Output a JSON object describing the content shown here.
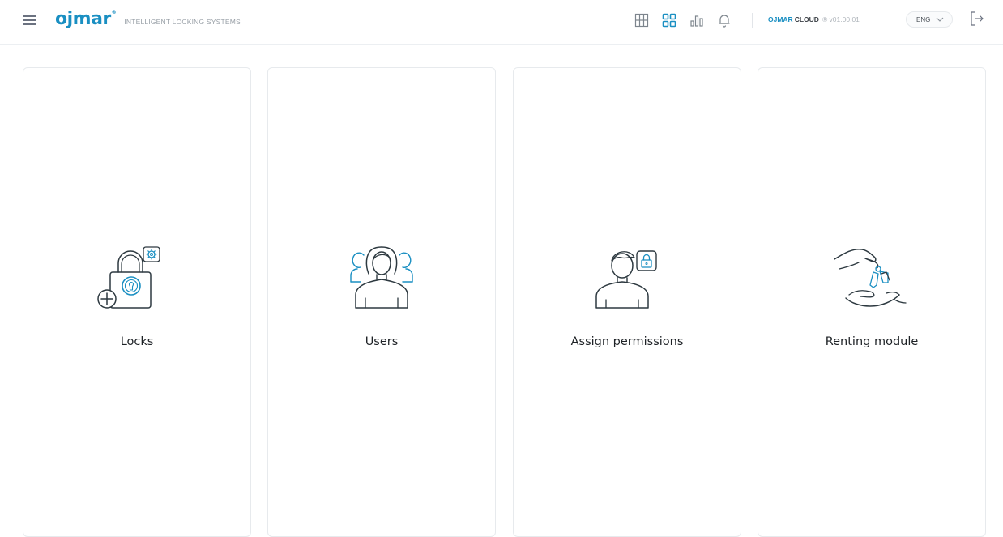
{
  "header": {
    "logo_text": "ojmar",
    "logo_mark": "®",
    "tagline": "INTELLIGENT LOCKING SYSTEMS",
    "nav_icons": [
      "grid-table-icon",
      "dashboard-icon",
      "bar-chart-icon",
      "bell-icon"
    ],
    "cloud_brand": "OJMAR",
    "cloud_product": "CLOUD",
    "version": "® v01.00.01",
    "language": "ENG",
    "accent_color": "#1a8fc2"
  },
  "cards": [
    {
      "label": "Locks",
      "icon": "padlock-gear-plus-icon"
    },
    {
      "label": "Users",
      "icon": "users-group-icon"
    },
    {
      "label": "Assign permissions",
      "icon": "user-lock-icon"
    },
    {
      "label": "Renting module",
      "icon": "hand-keys-icon"
    }
  ]
}
